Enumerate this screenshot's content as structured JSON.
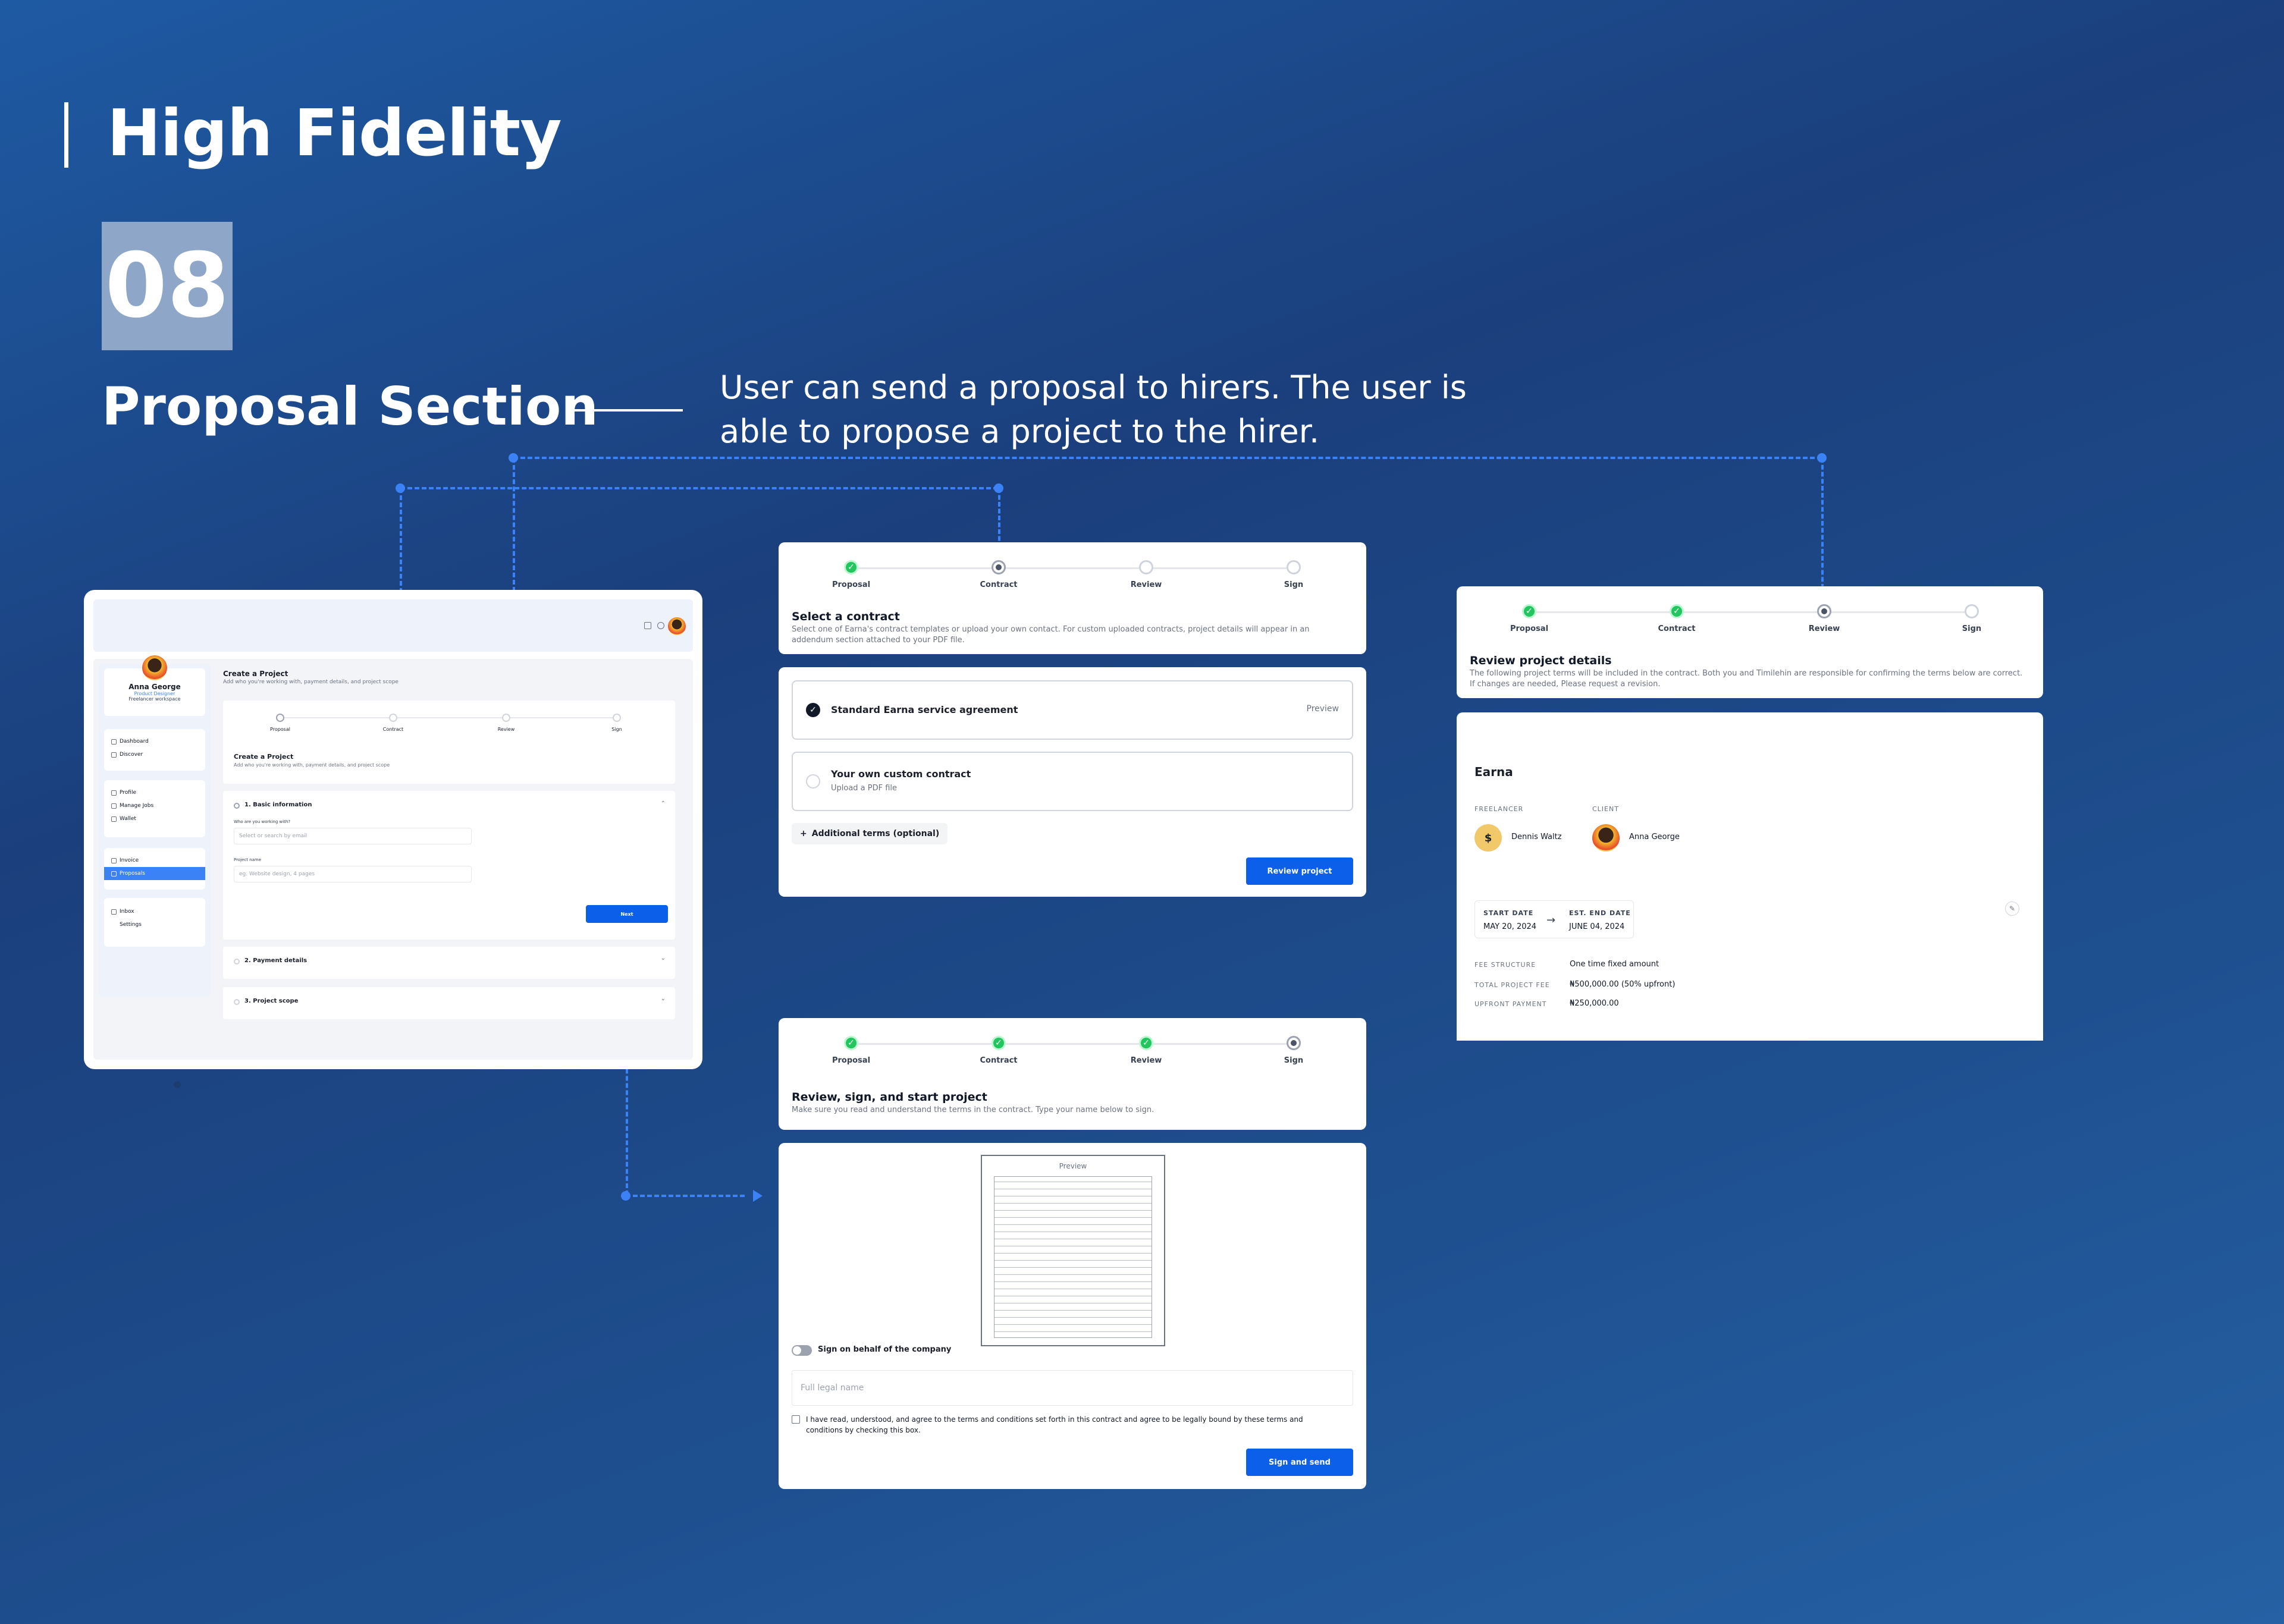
{
  "header": {
    "title": "High Fidelity",
    "number": "08",
    "section_title": "Proposal Section",
    "description_line1": "User can send a proposal to hirers. The user is",
    "description_line2": "able to propose a project to the hirer."
  },
  "steps": [
    "Proposal",
    "Contract",
    "Review",
    "Sign"
  ],
  "dashboard": {
    "user_name": "Anna George",
    "user_role": "Product Designer",
    "workspace": "Freelancer workspace",
    "nav_group1": [
      "Dashboard",
      "Discover"
    ],
    "nav_group2": [
      "Profile",
      "Manage Jobs",
      "Wallet"
    ],
    "nav_group3": [
      "Invoice",
      "Proposals"
    ],
    "nav_group4": [
      "Inbox",
      "Settings"
    ],
    "page_title": "Create a Project",
    "page_subtitle": "Add who you're working with, payment details, and project scope",
    "card_title": "Create a Project",
    "card_subtitle": "Add who you're working with, payment details, and project scope",
    "section1": "1. Basic information",
    "who_label": "Who are you working with?",
    "who_placeholder": "Select or search by email",
    "project_label": "Project name",
    "project_placeholder": "eg. Website design, 4 pages",
    "next_label": "Next",
    "section2": "2. Payment details",
    "section3": "3. Project scope"
  },
  "contract": {
    "title": "Select a contract",
    "subtitle": "Select one of Earna's contract templates or upload your own contact. For custom uploaded contracts, project details will appear in an addendum section attached to your PDF file.",
    "option1": "Standard Earna service agreement",
    "option1_action": "Preview",
    "option2": "Your own custom contract",
    "option2_sub": "Upload a PDF file",
    "additional": "Additional terms (optional)",
    "button": "Review project"
  },
  "review": {
    "title": "Review project details",
    "subtitle": "The following project terms will be included in the contract. Both you and Timilehin are responsible for confirming the terms below are correct. If changes are needed, Please request a revision.",
    "project_name": "Earna",
    "freelancer_label": "FREELANCER",
    "freelancer_name": "Dennis Waltz",
    "client_label": "CLIENT",
    "client_name": "Anna George",
    "start_label": "START DATE",
    "start_value": "MAY 20, 2024",
    "end_label": "EST. END DATE",
    "end_value": "JUNE 04, 2024",
    "fee_structure_label": "FEE STRUCTURE",
    "fee_structure_value": "One time fixed amount",
    "total_fee_label": "TOTAL PROJECT FEE",
    "total_fee_value": "₦500,000.00 (50% upfront)",
    "upfront_label": "UPFRONT PAYMENT",
    "upfront_value": "₦250,000.00"
  },
  "sign": {
    "title": "Review, sign, and start project",
    "subtitle": "Make sure you read and understand the terms in the contract. Type your name below to sign.",
    "preview_label": "Preview",
    "toggle_label": "Sign on behalf of the company",
    "name_placeholder": "Full legal name",
    "agree_text": "I have read, understood, and agree to the terms and conditions set forth in this contract and agree to be legally bound by these terms and conditions by checking this box.",
    "button": "Sign and send"
  }
}
